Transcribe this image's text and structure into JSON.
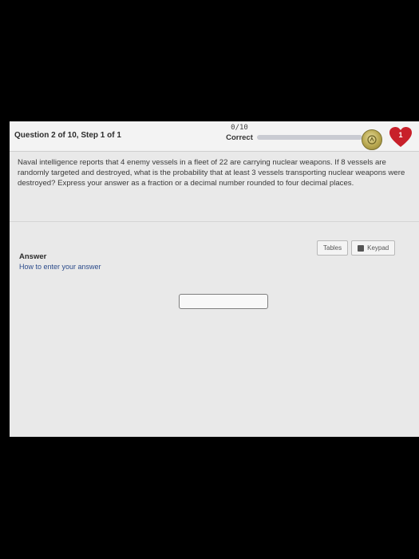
{
  "header": {
    "question_label": "Question 2 of 10, Step 1 of 1",
    "score_value": "0/10",
    "score_status": "Correct",
    "progress_fraction": 0,
    "lives": "1"
  },
  "problem": {
    "text": "Naval intelligence reports that 4 enemy vessels in a fleet of 22 are carrying nuclear weapons. If 8 vessels are randomly targeted and destroyed, what is the probability that at least 3 vessels transporting nuclear weapons were destroyed? Express your answer as a fraction or a decimal number rounded to four decimal places."
  },
  "tools": {
    "tables_label": "Tables",
    "keypad_label": "Keypad"
  },
  "answer": {
    "label": "Answer",
    "how_to_link": "How to enter your answer",
    "input_value": ""
  },
  "colors": {
    "heart": "#c8202a",
    "coin": "#b7a64e"
  }
}
